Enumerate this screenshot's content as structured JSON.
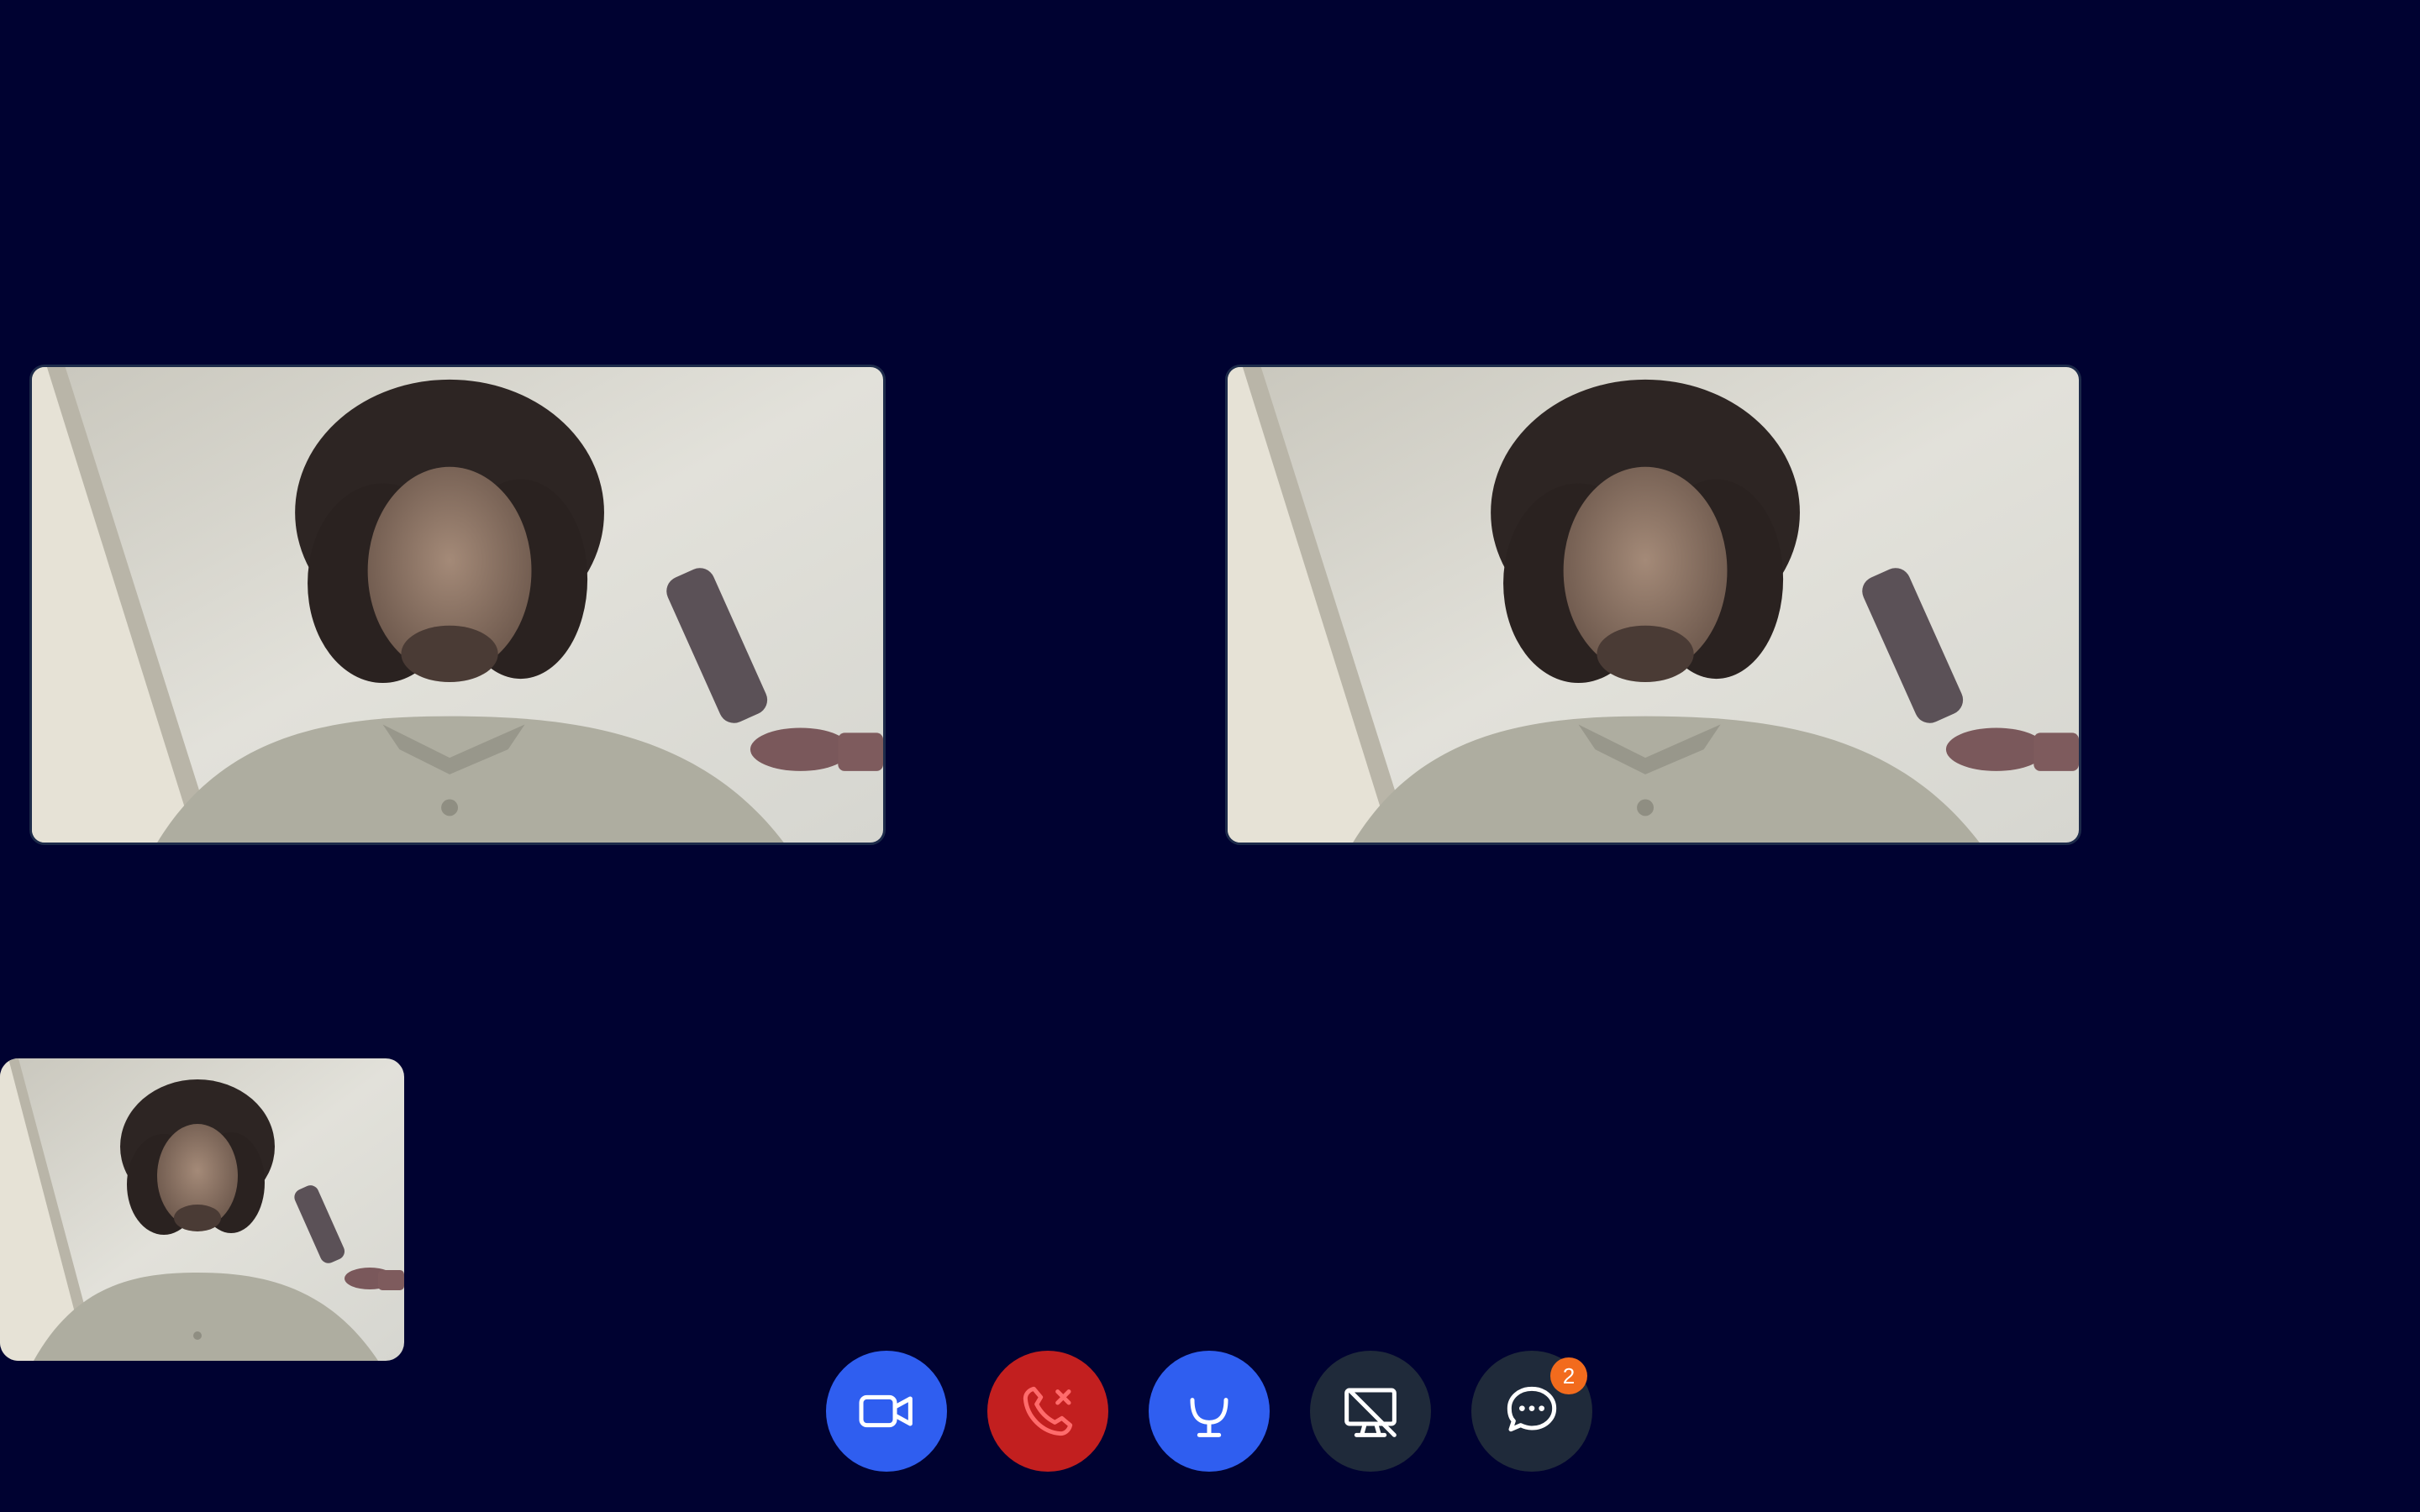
{
  "colors": {
    "background": "#000231",
    "primary_blue": "#2f5ef0",
    "danger_red": "#c21f1f",
    "danger_icon": "#ff6b6b",
    "neutral_dark": "#1f2a3a",
    "badge_orange": "#f26b1d"
  },
  "video_tiles": [
    {
      "role": "remote-participant-video"
    },
    {
      "role": "remote-participant-video"
    },
    {
      "role": "local-self-preview"
    }
  ],
  "controls": {
    "camera": {
      "icon": "video-camera-icon"
    },
    "hangup": {
      "icon": "phone-hangup-icon"
    },
    "mic": {
      "icon": "microphone-icon"
    },
    "share": {
      "icon": "screen-share-off-icon"
    },
    "chat": {
      "icon": "chat-bubble-icon",
      "badge_count": "2"
    }
  }
}
